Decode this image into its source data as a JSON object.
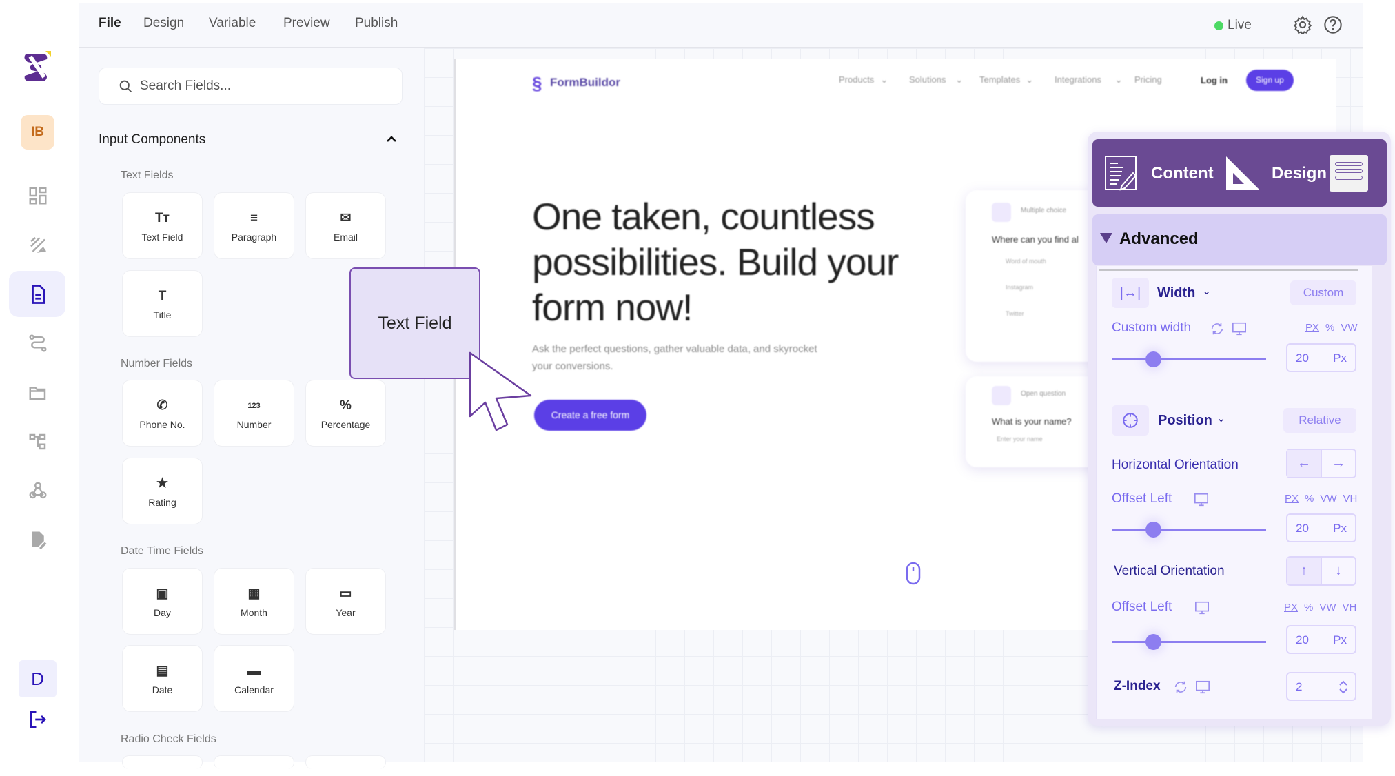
{
  "rail": {
    "user_initials": "IB",
    "bottom_initial": "D",
    "items": [
      "grid-icon",
      "draw-icon",
      "document-icon",
      "route-icon",
      "folder-icon",
      "sitemap-icon",
      "webhook-icon",
      "file-edit-icon"
    ],
    "active_item": "document-icon"
  },
  "menu": {
    "items": [
      "File",
      "Design",
      "Variable",
      "Preview",
      "Publish"
    ],
    "active": "File"
  },
  "status": {
    "label": "Live",
    "color": "#4cd964"
  },
  "search": {
    "placeholder": "Search Fields..."
  },
  "components": {
    "title": "Input Components",
    "sections": [
      {
        "label": "Text Fields",
        "items": [
          {
            "icon": "Tт",
            "label": "Text Field"
          },
          {
            "icon": "≡",
            "label": "Paragraph"
          },
          {
            "icon": "✉",
            "label": "Email"
          },
          {
            "icon": "T",
            "label": "Title"
          }
        ]
      },
      {
        "label": "Number Fields",
        "items": [
          {
            "icon": "✆",
            "label": "Phone No."
          },
          {
            "icon": "123",
            "label": "Number"
          },
          {
            "icon": "%",
            "label": "Percentage"
          },
          {
            "icon": "★",
            "label": "Rating"
          }
        ]
      },
      {
        "label": "Date Time Fields",
        "items": [
          {
            "icon": "▣",
            "label": "Day"
          },
          {
            "icon": "▦",
            "label": "Month"
          },
          {
            "icon": "▭",
            "label": "Year"
          },
          {
            "icon": "▤",
            "label": "Date"
          },
          {
            "icon": "▬",
            "label": "Calendar"
          }
        ]
      },
      {
        "label": "Radio Check Fields",
        "items": []
      }
    ]
  },
  "drag_preview": {
    "label": "Text Field"
  },
  "preview": {
    "brand": "FormBuildor",
    "nav": [
      "Products",
      "Solutions",
      "Templates",
      "Integrations",
      "Pricing"
    ],
    "login": "Log in",
    "signup": "Sign up",
    "headline": [
      "One taken, countless",
      "possibilities. Build your",
      "form now!"
    ],
    "subtext": [
      "Ask the perfect questions, gather valuable data, and skyrocket",
      "your conversions."
    ],
    "cta": "Create a free form",
    "card1": {
      "type": "Multiple choice",
      "question": "Where can you find al",
      "options": [
        "Word of mouth",
        "Instagram",
        "Twitter"
      ]
    },
    "card2": {
      "type": "Open question",
      "question": "What is your name?",
      "placeholder": "Enter your name"
    },
    "accent": "#5b3fe6"
  },
  "panel": {
    "tabs": [
      "Content",
      "Design"
    ],
    "header_color": "#6a4a93",
    "section": "Advanced",
    "width": {
      "label": "Width",
      "mode": "Custom",
      "custom_label": "Custom width",
      "units": [
        "PX",
        "%",
        "VW"
      ],
      "value": "20",
      "unit": "Px",
      "slider_percent": 27
    },
    "position": {
      "label": "Position",
      "mode": "Relative",
      "horizontal": {
        "label": "Horizontal Orientation",
        "options": [
          "←",
          "→"
        ],
        "selected": "←"
      },
      "offset1": {
        "label": "Offset Left",
        "units": [
          "PX",
          "%",
          "VW",
          "VH"
        ],
        "value": "20",
        "unit": "Px",
        "slider_percent": 27
      },
      "vertical": {
        "label": "Vertical Orientation",
        "options": [
          "↑",
          "↓"
        ],
        "selected": "↑"
      },
      "offset2": {
        "label": "Offset Left",
        "units": [
          "PX",
          "%",
          "VW",
          "VH"
        ],
        "value": "20",
        "unit": "Px",
        "slider_percent": 27
      }
    },
    "zindex": {
      "label": "Z-Index",
      "value": "2"
    }
  }
}
